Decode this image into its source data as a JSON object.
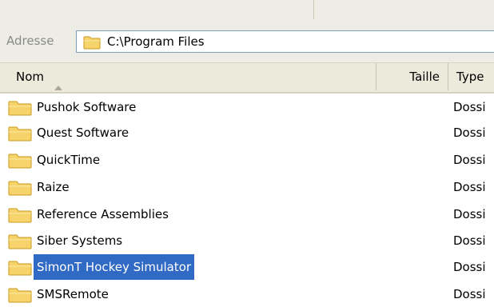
{
  "address": {
    "label": "Adresse",
    "path": "C:\\Program Files",
    "folder_icon": "folder-icon"
  },
  "columns": {
    "name": "Nom",
    "size": "Taille",
    "type": "Type"
  },
  "sort": {
    "column": "Nom",
    "direction": "ascending",
    "icon": "sort-ascending-icon"
  },
  "files": [
    {
      "name": "Pushok Software",
      "size": "",
      "type": "Dossi",
      "icon": "folder-icon",
      "selected": false
    },
    {
      "name": "Quest Software",
      "size": "",
      "type": "Dossi",
      "icon": "folder-icon",
      "selected": false
    },
    {
      "name": "QuickTime",
      "size": "",
      "type": "Dossi",
      "icon": "folder-icon",
      "selected": false
    },
    {
      "name": "Raize",
      "size": "",
      "type": "Dossi",
      "icon": "folder-icon",
      "selected": false
    },
    {
      "name": "Reference Assemblies",
      "size": "",
      "type": "Dossi",
      "icon": "folder-icon",
      "selected": false
    },
    {
      "name": "Siber Systems",
      "size": "",
      "type": "Dossi",
      "icon": "folder-icon",
      "selected": false
    },
    {
      "name": "SimonT Hockey Simulator",
      "size": "",
      "type": "Dossi",
      "icon": "folder-icon",
      "selected": true
    },
    {
      "name": "SMSRemote",
      "size": "",
      "type": "Dossi",
      "icon": "folder-icon",
      "selected": false
    }
  ],
  "colors": {
    "selection": "#316ac5",
    "selection_text": "#ffffff",
    "chrome": "#eeede5",
    "header": "#ebeadb",
    "address_border": "#7f9db9",
    "folder_fill": "#f7d46b",
    "folder_edge": "#c89a1c"
  }
}
